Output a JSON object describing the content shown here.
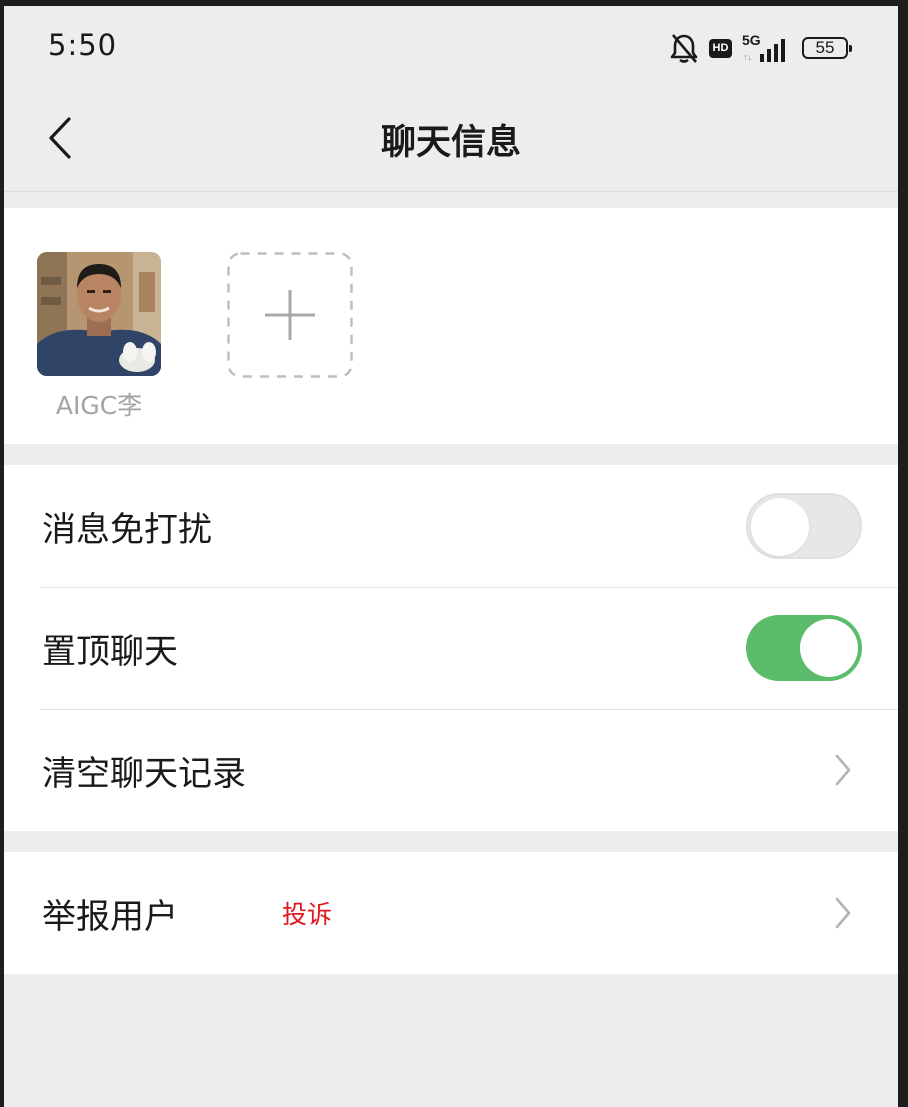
{
  "status_bar": {
    "time": "5:50",
    "network": "5G",
    "hd": "HD",
    "battery": "55"
  },
  "nav": {
    "title": "聊天信息"
  },
  "members": [
    {
      "name": "AIGC李"
    }
  ],
  "settings": {
    "mute_label": "消息免打扰",
    "mute_on": false,
    "pin_label": "置顶聊天",
    "pin_on": true,
    "clear_label": "清空聊天记录"
  },
  "report": {
    "label": "举报用户",
    "tag": "投诉",
    "tag_color": "#e0191e"
  },
  "colors": {
    "toggle_on": "#5bbd6b",
    "toggle_off": "#e7e7e7",
    "background": "#ededed"
  }
}
